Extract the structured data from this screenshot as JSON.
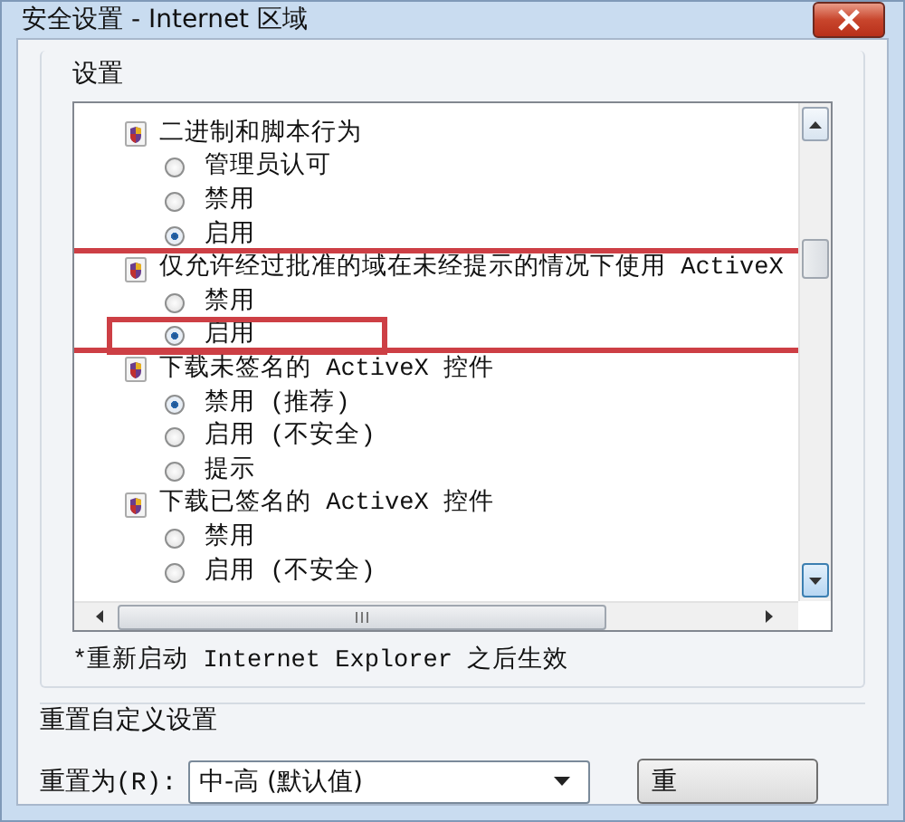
{
  "window": {
    "title": "安全设置 - Internet 区域"
  },
  "settings": {
    "label": "设置",
    "groups": [
      {
        "label": "二进制和脚本行为",
        "highlighted": false,
        "options": [
          {
            "label": "管理员认可",
            "selected": false,
            "highlighted": false
          },
          {
            "label": "禁用",
            "selected": false,
            "highlighted": false
          },
          {
            "label": "启用",
            "selected": true,
            "highlighted": false
          }
        ]
      },
      {
        "label": "仅允许经过批准的域在未经提示的情况下使用 ActiveX",
        "highlighted": true,
        "options": [
          {
            "label": "禁用",
            "selected": false,
            "highlighted": false
          },
          {
            "label": "启用",
            "selected": true,
            "highlighted": true
          }
        ]
      },
      {
        "label": "下载未签名的 ActiveX 控件",
        "highlighted": false,
        "options": [
          {
            "label": "禁用 (推荐)",
            "selected": true,
            "highlighted": false
          },
          {
            "label": "启用 (不安全)",
            "selected": false,
            "highlighted": false
          },
          {
            "label": "提示",
            "selected": false,
            "highlighted": false
          }
        ]
      },
      {
        "label": "下载已签名的 ActiveX 控件",
        "highlighted": false,
        "options": [
          {
            "label": "禁用",
            "selected": false,
            "highlighted": false
          },
          {
            "label": "启用 (不安全)",
            "selected": false,
            "highlighted": false
          }
        ]
      }
    ],
    "note": "*重新启动 Internet Explorer 之后生效"
  },
  "reset": {
    "label": "重置自定义设置",
    "field_label": "重置为(R):",
    "value": "中-高 (默认值)",
    "button": "重"
  }
}
